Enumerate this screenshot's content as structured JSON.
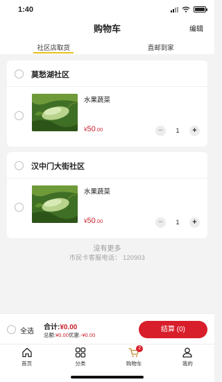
{
  "status": {
    "time": "1:40"
  },
  "header": {
    "title": "购物车",
    "edit_label": "编辑"
  },
  "tabs": [
    {
      "label": "社区店取货",
      "active": true
    },
    {
      "label": "直邮到家",
      "active": false
    }
  ],
  "stores": [
    {
      "name": "莫愁湖社区",
      "item": {
        "name": "水果蔬菜",
        "price_symbol": "¥",
        "price_int": "50",
        "price_dec": ".00",
        "quantity": "1",
        "minus": "−",
        "plus": "+"
      }
    },
    {
      "name": "汉中门大街社区",
      "item": {
        "name": "水果蔬菜",
        "price_symbol": "¥",
        "price_int": "50",
        "price_dec": ".00",
        "quantity": "1",
        "minus": "−",
        "plus": "+"
      }
    }
  ],
  "footer_notes": {
    "no_more": "没有更多",
    "hotline": "市民卡客服电话：  120903"
  },
  "checkout": {
    "select_all": "全选",
    "total_label": "合计:",
    "total_value": "¥0.00",
    "subtotal_label": "总额:",
    "subtotal_value": "¥0.00",
    "discount_label": "优惠:",
    "discount_value": "-¥0.00",
    "pay_label": "结算 (0)"
  },
  "tabbar": [
    {
      "label": "首页",
      "icon": "home-icon"
    },
    {
      "label": "分类",
      "icon": "category-icon"
    },
    {
      "label": "购物车",
      "icon": "cart-icon",
      "badge": "2",
      "active": true
    },
    {
      "label": "我的",
      "icon": "user-icon"
    }
  ],
  "colors": {
    "accent": "#d81e2a",
    "price": "#c9212d",
    "tab_indicator": "#e8c21a",
    "cart_active": "#c28a2e"
  }
}
